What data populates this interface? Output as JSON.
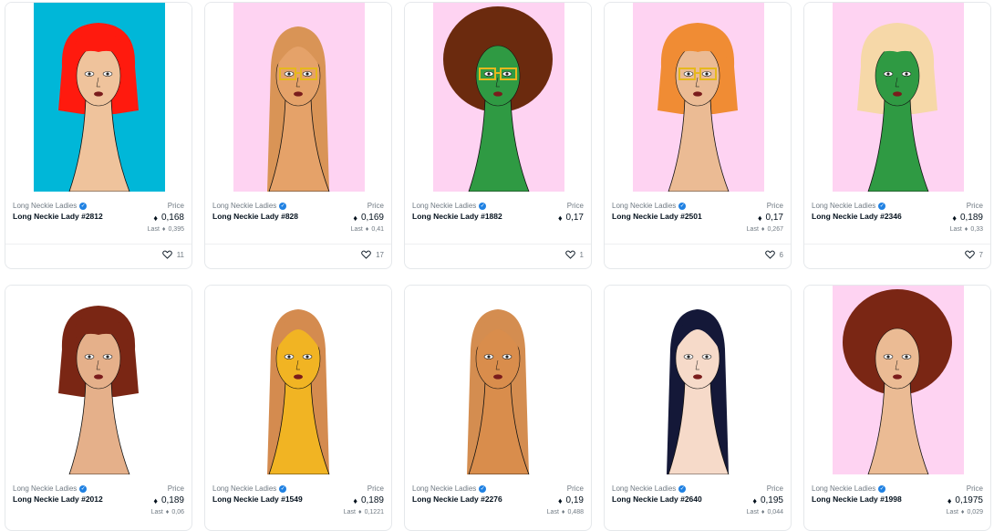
{
  "cards": [
    {
      "collection": "Long Neckie Ladies",
      "name": "Long Neckie Lady #2812",
      "price_label": "Price",
      "price": "0,168",
      "last_label": "Last",
      "last": "0,395",
      "likes": "11",
      "bg": "#00b7d8",
      "skin": "#efc39c",
      "hair": "#ff1a0e",
      "hair_style": "bob",
      "shirt": "#7b3fa8",
      "glasses": false
    },
    {
      "collection": "Long Neckie Ladies",
      "name": "Long Neckie Lady #828",
      "price_label": "Price",
      "price": "0,169",
      "last_label": "Last",
      "last": "0,41",
      "likes": "17",
      "bg": "#fed3f2",
      "skin": "#e5a269",
      "hair": "#d99456",
      "hair_style": "long",
      "shirt": "#9ed8c8",
      "glasses": true
    },
    {
      "collection": "Long Neckie Ladies",
      "name": "Long Neckie Lady #1882",
      "price_label": "Price",
      "price": "0,17",
      "last_label": "",
      "last": "",
      "likes": "1",
      "bg": "#fed3f2",
      "skin": "#2f9a43",
      "hair": "#6b2a0e",
      "hair_style": "afro",
      "shirt": "#7b3fa8",
      "glasses": true
    },
    {
      "collection": "Long Neckie Ladies",
      "name": "Long Neckie Lady #2501",
      "price_label": "Price",
      "price": "0,17",
      "last_label": "Last",
      "last": "0,267",
      "likes": "6",
      "bg": "#fed3f2",
      "skin": "#ebbb94",
      "hair": "#f08c34",
      "hair_style": "bob",
      "shirt": "#a8d88a",
      "glasses": true
    },
    {
      "collection": "Long Neckie Ladies",
      "name": "Long Neckie Lady #2346",
      "price_label": "Price",
      "price": "0,189",
      "last_label": "Last",
      "last": "0,33",
      "likes": "7",
      "bg": "#fed3f2",
      "skin": "#2f9a43",
      "hair": "#f6d8a8",
      "hair_style": "bob",
      "shirt": "#7b3fa8",
      "glasses": false
    },
    {
      "collection": "Long Neckie Ladies",
      "name": "Long Neckie Lady #2012",
      "price_label": "Price",
      "price": "0,189",
      "last_label": "Last",
      "last": "0,06",
      "likes": "",
      "bg": "#ffffff",
      "skin": "#e5b08a",
      "hair": "#7a2614",
      "hair_style": "bob",
      "shirt": "#3b3e9a",
      "glasses": false
    },
    {
      "collection": "Long Neckie Ladies",
      "name": "Long Neckie Lady #1549",
      "price_label": "Price",
      "price": "0,189",
      "last_label": "Last",
      "last": "0,1221",
      "likes": "",
      "bg": "#ffffff",
      "skin": "#f1b423",
      "hair": "#d48b4f",
      "hair_style": "long",
      "shirt": "#7a3a18",
      "glasses": false
    },
    {
      "collection": "Long Neckie Ladies",
      "name": "Long Neckie Lady #2276",
      "price_label": "Price",
      "price": "0,19",
      "last_label": "Last",
      "last": "0,488",
      "likes": "",
      "bg": "#ffffff",
      "skin": "#d98d4c",
      "hair": "#d48d50",
      "hair_style": "long",
      "shirt": "#7b3fa8",
      "glasses": false
    },
    {
      "collection": "Long Neckie Ladies",
      "name": "Long Neckie Lady #2640",
      "price_label": "Price",
      "price": "0,195",
      "last_label": "Last",
      "last": "0,044",
      "likes": "",
      "bg": "#ffffff",
      "skin": "#f6dac9",
      "hair": "#141838",
      "hair_style": "long",
      "shirt": "#29a8e0",
      "glasses": false
    },
    {
      "collection": "Long Neckie Ladies",
      "name": "Long Neckie Lady #1998",
      "price_label": "Price",
      "price": "0,1975",
      "last_label": "Last",
      "last": "0,029",
      "likes": "",
      "bg": "#fed3f2",
      "skin": "#ebbb94",
      "hair": "#7a2614",
      "hair_style": "afro",
      "shirt": "#8a3a1a",
      "glasses": false
    }
  ],
  "icons": {
    "eth": "ethereum-icon",
    "heart": "heart-icon",
    "verified": "verified-badge-icon"
  }
}
